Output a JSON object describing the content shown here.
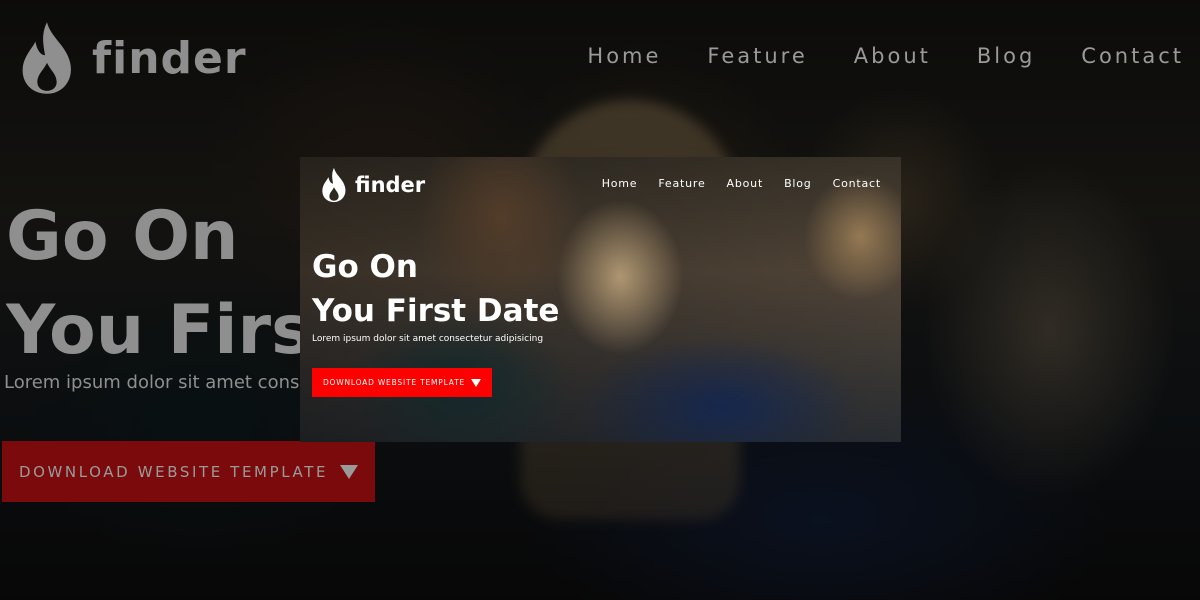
{
  "brand": {
    "name": "finder",
    "icon": "flame-icon"
  },
  "nav": {
    "items": [
      "Home",
      "Feature",
      "About",
      "Blog",
      "Contact"
    ]
  },
  "hero": {
    "title_line1": "Go On",
    "title_line2": "You First Date",
    "subtitle": "Lorem ipsum dolor sit amet consectetur adipisicing",
    "cta_label": "DOWNLOAD WEBSITE TEMPLATE",
    "cta_icon": "caret-down-icon"
  },
  "colors": {
    "accent": "#ff0000",
    "text": "#ffffff"
  }
}
